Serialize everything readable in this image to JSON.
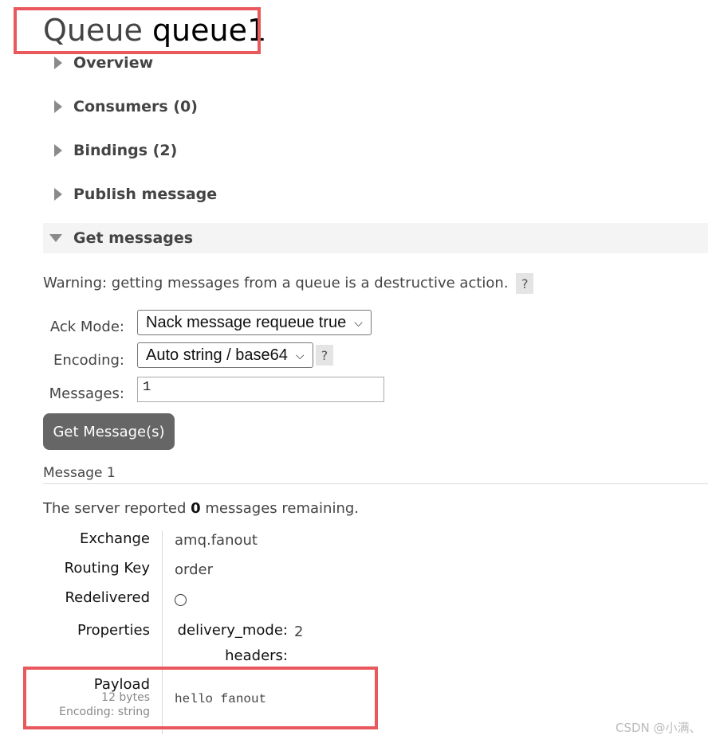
{
  "title": {
    "prefix": "Queue",
    "name": "queue1"
  },
  "sections": [
    {
      "label": "Overview",
      "expanded": false
    },
    {
      "label": "Consumers (0)",
      "expanded": false
    },
    {
      "label": "Bindings (2)",
      "expanded": false
    },
    {
      "label": "Publish message",
      "expanded": false
    },
    {
      "label": "Get messages",
      "expanded": true
    }
  ],
  "get_messages": {
    "warning": "Warning: getting messages from a queue is a destructive action.",
    "help_label": "?",
    "ack_mode": {
      "label": "Ack Mode:",
      "value": "Nack message requeue true"
    },
    "encoding": {
      "label": "Encoding:",
      "value": "Auto string / base64"
    },
    "messages": {
      "label": "Messages:",
      "value": "1"
    },
    "button_label": "Get Message(s)"
  },
  "result": {
    "heading": "Message 1",
    "remaining_prefix": "The server reported",
    "remaining_count": "0",
    "remaining_suffix": "messages remaining.",
    "exchange": {
      "label": "Exchange",
      "value": "amq.fanout"
    },
    "routing_key": {
      "label": "Routing Key",
      "value": "order"
    },
    "redelivered": {
      "label": "Redelivered",
      "checked": false
    },
    "properties": {
      "label": "Properties",
      "delivery_mode_key": "delivery_mode:",
      "delivery_mode_value": "2",
      "headers_key": "headers:"
    },
    "payload": {
      "label": "Payload",
      "size": "12 bytes",
      "encoding": "Encoding: string",
      "value": "hello fanout"
    }
  },
  "watermark": "CSDN @小满、",
  "colors": {
    "highlight": "#e8585d",
    "button": "#666666"
  }
}
